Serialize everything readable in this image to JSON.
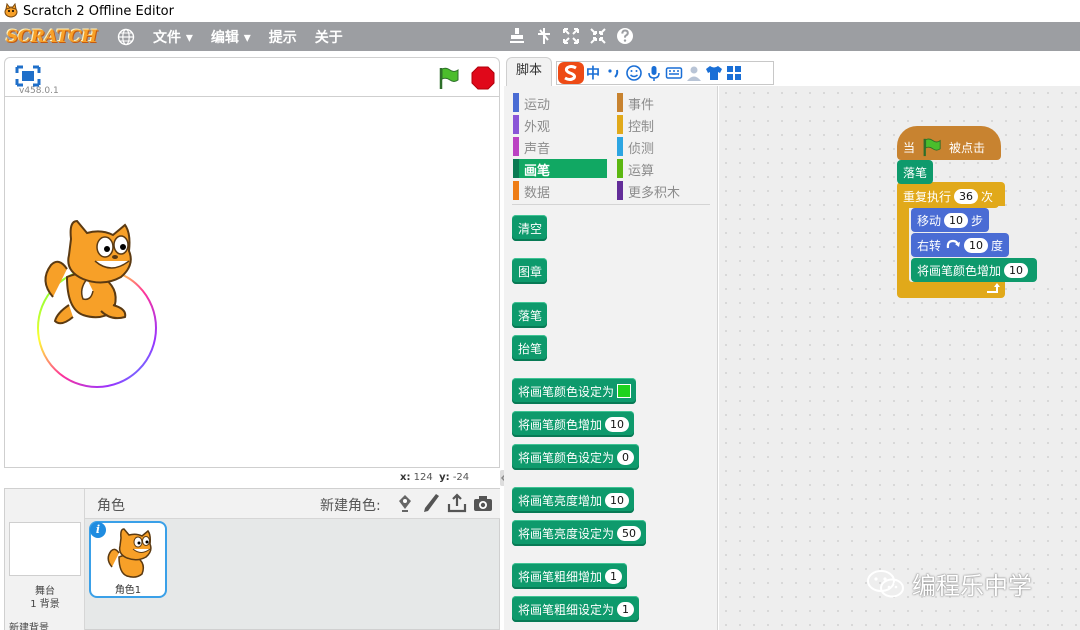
{
  "window": {
    "title": "Scratch 2 Offline Editor"
  },
  "menubar": {
    "logo": "SCRATCH",
    "items": [
      "文件 ▾",
      "编辑 ▾",
      "提示",
      "关于"
    ]
  },
  "stage": {
    "version": "v458.0.1",
    "coords_x_label": "x:",
    "coords_x": "124",
    "coords_y_label": "y:",
    "coords_y": "-24"
  },
  "sprites": {
    "header_label": "角色",
    "new_sprite_label": "新建角色:",
    "stage_label": "舞台",
    "backdrop_count": "1 背景",
    "new_backdrop": "新建背景",
    "sprite1_name": "角色1"
  },
  "tabs": {
    "script": "脚本"
  },
  "ime": {
    "lang": "中"
  },
  "categories": [
    {
      "label": "运动",
      "color": "#4a6cd4"
    },
    {
      "label": "事件",
      "color": "#c88330"
    },
    {
      "label": "外观",
      "color": "#8a55d7"
    },
    {
      "label": "控制",
      "color": "#e1a91a"
    },
    {
      "label": "声音",
      "color": "#bb42c3"
    },
    {
      "label": "侦测",
      "color": "#2ca5e2"
    },
    {
      "label": "画笔",
      "color": "#0e9a6c"
    },
    {
      "label": "运算",
      "color": "#5cb712"
    },
    {
      "label": "数据",
      "color": "#ee7d16"
    },
    {
      "label": "更多积木",
      "color": "#632d99"
    }
  ],
  "palette_blocks": [
    {
      "label": "清空"
    },
    {
      "label": "图章"
    },
    {
      "label": "落笔"
    },
    {
      "label": "抬笔"
    },
    {
      "label": "将画笔颜色设定为",
      "swatch": "#1ed31e"
    },
    {
      "label": "将画笔颜色增加",
      "value": "10"
    },
    {
      "label": "将画笔颜色设定为",
      "value": "0"
    },
    {
      "label": "将画笔亮度增加",
      "value": "10"
    },
    {
      "label": "将画笔亮度设定为",
      "value": "50"
    },
    {
      "label": "将画笔粗细增加",
      "value": "1"
    },
    {
      "label": "将画笔粗细设定为",
      "value": "1"
    }
  ],
  "script": {
    "hat_when": "当",
    "hat_clicked": "被点击",
    "pen_down": "落笔",
    "repeat_label": "重复执行",
    "repeat_count": "36",
    "repeat_suffix": "次",
    "move_label": "移动",
    "move_steps": "10",
    "move_suffix": "步",
    "turn_label": "右转",
    "turn_degrees": "10",
    "turn_suffix": "度",
    "color_change_label": "将画笔颜色增加",
    "color_change_value": "10"
  },
  "watermark": "编程乐中学"
}
